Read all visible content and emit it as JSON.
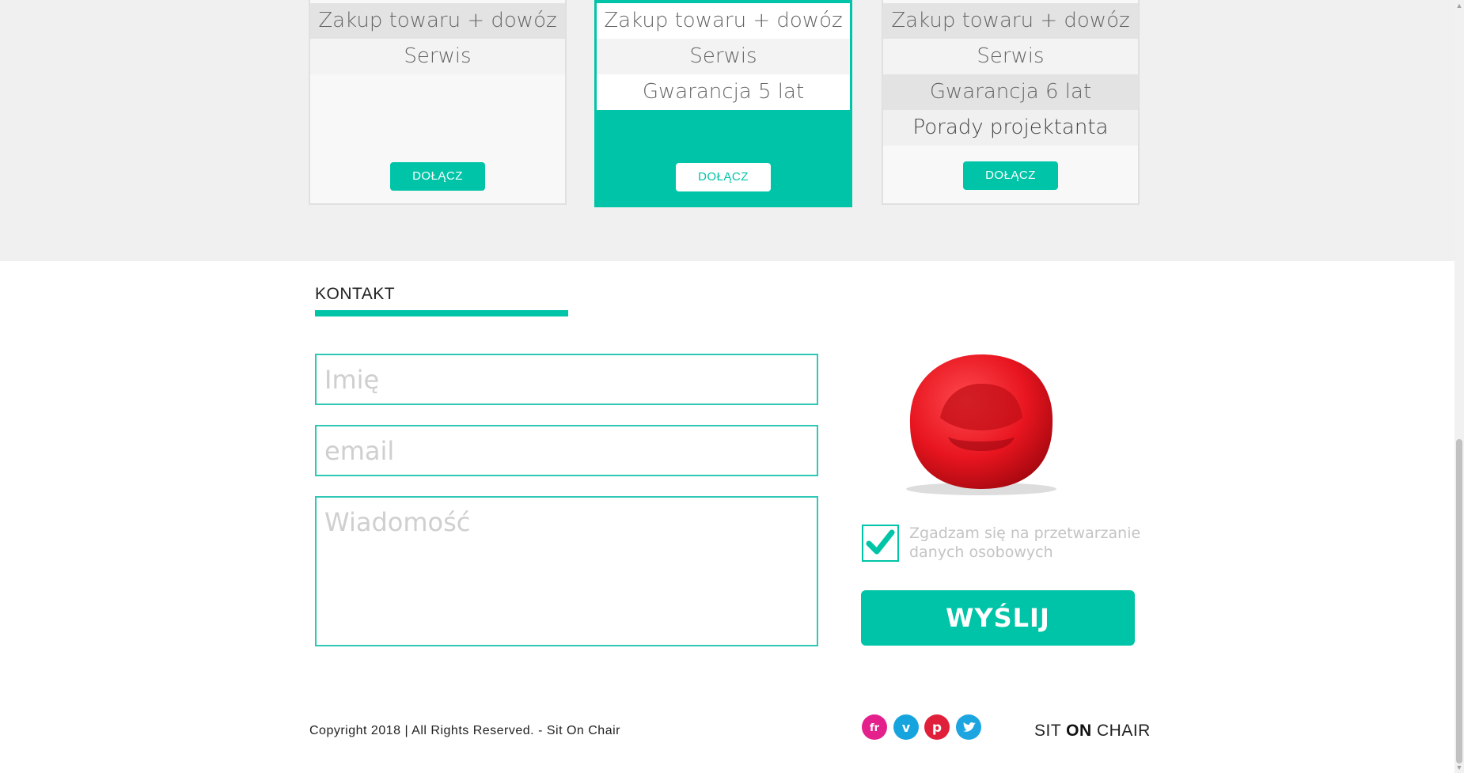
{
  "pricing": {
    "cards": [
      {
        "rows": [
          "Zakup towaru + dowóz",
          "Serwis"
        ],
        "button": "DOŁĄCZ"
      },
      {
        "rows": [
          "Zakup towaru + dowóz",
          "Serwis",
          "Gwarancja 5 lat"
        ],
        "button": "DOŁĄCZ"
      },
      {
        "rows": [
          "Zakup towaru + dowóz",
          "Serwis",
          "Gwarancja 6 lat",
          "Porady projektanta"
        ],
        "button": "DOŁĄCZ"
      }
    ]
  },
  "contact": {
    "title": "KONTAKT",
    "name_placeholder": "Imię",
    "email_placeholder": "email",
    "message_placeholder": "Wiadomość",
    "consent_label": "Zgadzam się na przetwarzanie danych osobowych",
    "consent_checked": true,
    "submit_label": "WYŚLIJ"
  },
  "footer": {
    "copyright": "Copyright 2018 | All Rights Reserved. - Sit On Chair",
    "social": [
      {
        "icon": "flickr-icon",
        "glyph": "fr",
        "color": "#e3208b"
      },
      {
        "icon": "vimeo-icon",
        "glyph": "v",
        "color": "#16a4de"
      },
      {
        "icon": "pinterest-icon",
        "glyph": "p",
        "color": "#e0203a"
      },
      {
        "icon": "twitter-icon",
        "glyph": "t",
        "color": "#1ca5e0"
      }
    ],
    "brand_part1": "SIT",
    "brand_part2": "ON",
    "brand_part3": "CHAIR"
  },
  "colors": {
    "accent": "#00c4a7",
    "chair": "#e8151f"
  }
}
